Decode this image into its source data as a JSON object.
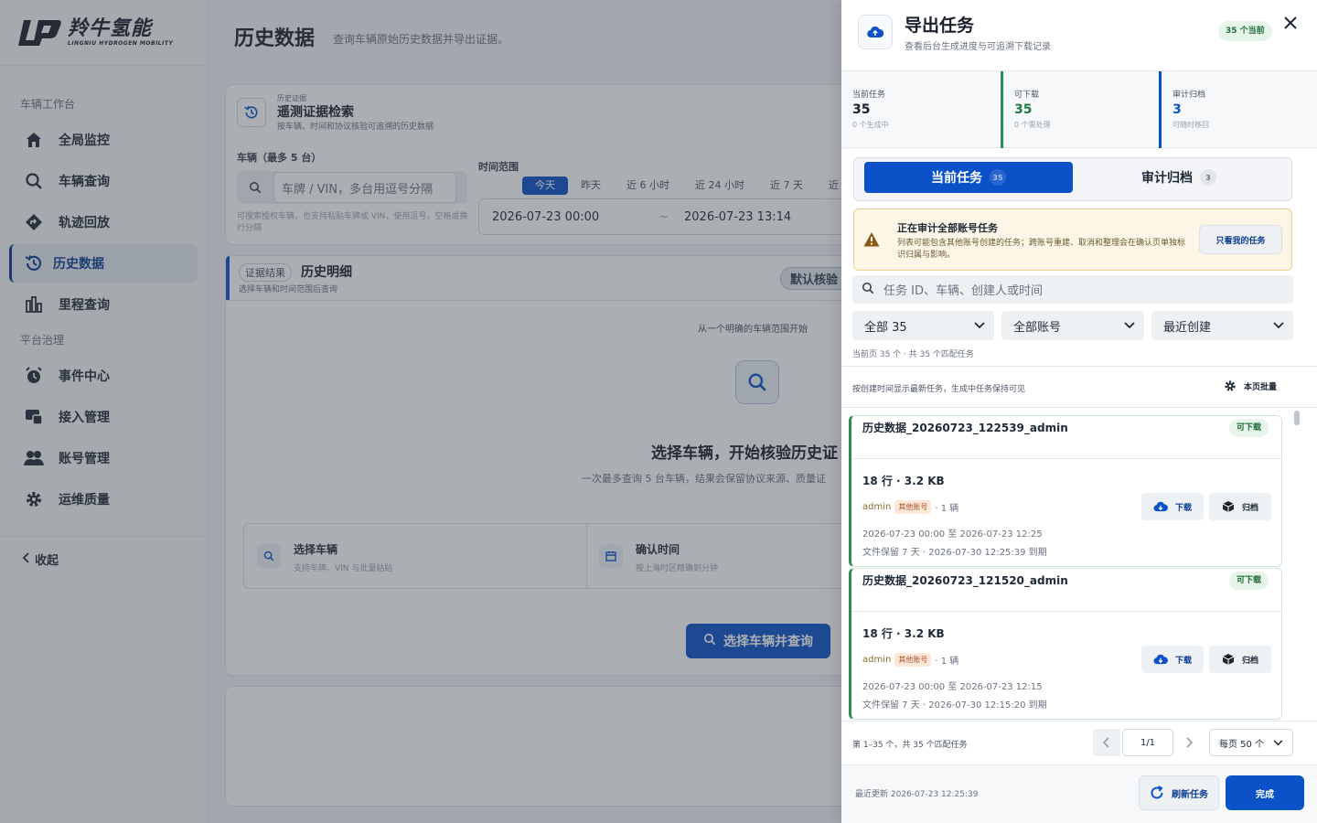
{
  "brand": {
    "name_cn": "羚牛氢能",
    "name_en": "LINGNIU HYDROGEN MOBILITY"
  },
  "sidebar": {
    "groups": [
      "车辆工作台",
      "平台治理"
    ],
    "items": [
      {
        "label": "全局监控",
        "icon": "home-icon"
      },
      {
        "label": "车辆查询",
        "icon": "search-icon"
      },
      {
        "label": "轨迹回放",
        "icon": "route-icon"
      },
      {
        "label": "历史数据",
        "icon": "history-icon",
        "active": true
      },
      {
        "label": "里程查询",
        "icon": "bar-chart-icon"
      },
      {
        "label": "事件中心",
        "icon": "alarm-clock-icon"
      },
      {
        "label": "接入管理",
        "icon": "device-icon"
      },
      {
        "label": "账号管理",
        "icon": "users-icon"
      },
      {
        "label": "运维质量",
        "icon": "gear-icon"
      }
    ],
    "collapse_label": "收起"
  },
  "page": {
    "title": "历史数据",
    "subtitle": "查询车辆原始历史数据并导出证据。",
    "search_card": {
      "mini": "历史证据",
      "title": "遥测证据检索",
      "desc": "按车辆、时间和协议核验可追溯的历史数据",
      "vehicle_label": "车辆（最多 5 台）",
      "vehicle_placeholder": "车牌 / VIN，多台用逗号分隔",
      "vehicle_hint": "可搜索授权车辆，也支持粘贴车牌或 VIN，使用逗号、空格或换行分隔",
      "time_label": "时间范围",
      "time_presets": [
        "今天",
        "昨天",
        "近 6 小时",
        "近 24 小时",
        "近 7 天",
        "近"
      ],
      "start_time": "2026-07-23 00:00",
      "separator": "~",
      "end_time": "2026-07-23 13:14"
    },
    "result_card": {
      "tag": "证据结果",
      "title": "历史明细",
      "desc": "选择车辆和时间范围后查询",
      "verify_tag": "默认核验 ·",
      "hint_top": "从一个明确的车辆范围开始",
      "empty_title": "选择车辆，开始核验历史证",
      "empty_desc": "一次最多查询 5 台车辆，结果会保留协议来源、质量证",
      "step1_title": "选择车辆",
      "step1_desc": "支持车牌、VIN 与批量粘贴",
      "step2_title": "确认时间",
      "step2_desc": "按上海时区精确到分钟",
      "query_button": "选择车辆并查询"
    }
  },
  "drawer": {
    "title": "导出任务",
    "subtitle": "查看后台生成进度与可追溯下载记录",
    "badge": "35 个当前",
    "stats": [
      {
        "label": "当前任务",
        "value": "35",
        "desc": "0 个生成中",
        "color": "#1a1f2b"
      },
      {
        "label": "可下载",
        "value": "35",
        "desc": "0 个需处理",
        "color": "#1f7a45"
      },
      {
        "label": "审计归档",
        "value": "3",
        "desc": "可随时移回",
        "color": "#0b52c9"
      }
    ],
    "tabs": [
      {
        "label": "当前任务",
        "count": "35"
      },
      {
        "label": "审计归档",
        "count": "3"
      }
    ],
    "warning": {
      "title": "正在审计全部账号任务",
      "desc": "列表可能包含其他账号创建的任务；跨账号重建、取消和整理会在确认页单独标识归属与影响。",
      "button": "只看我的任务"
    },
    "search_placeholder": "任务 ID、车辆、创建人或时间",
    "filters": [
      "全部 35",
      "全部账号",
      "最近创建"
    ],
    "match_text": "当前页 35 个 · 共 35 个匹配任务",
    "sort_text": "按创建时间显示最新任务，生成中任务保持可见",
    "batch_label": "本页批量",
    "tasks": [
      {
        "name": "历史数据_20260723_122539_admin",
        "status": "可下载",
        "size": "18 行 · 3.2 KB",
        "owner": "admin",
        "owner_tag": "其他账号",
        "vehicles": "· 1 辆",
        "range": "2026-07-23 00:00 至 2026-07-23 12:25",
        "keep": "文件保留 7 天 · 2026-07-30 12:25:39 到期",
        "download": "下载",
        "archive": "归档"
      },
      {
        "name": "历史数据_20260723_121520_admin",
        "status": "可下载",
        "size": "18 行 · 3.2 KB",
        "owner": "admin",
        "owner_tag": "其他账号",
        "vehicles": "· 1 辆",
        "range": "2026-07-23 00:00 至 2026-07-23 12:15",
        "keep": "文件保留 7 天 · 2026-07-30 12:15:20 到期",
        "download": "下载",
        "archive": "归档"
      }
    ],
    "pager_text": "第 1–35 个，共 35 个匹配任务",
    "page_num": "1/1",
    "page_size": "每页 50 个",
    "last_update": "最近更新 2026-07-23 12:25:39",
    "refresh_label": "刷新任务",
    "done_label": "完成"
  },
  "colors": {
    "primary": "#0b52c9",
    "success": "#1f7a45",
    "warning_bg": "#fdf6e7"
  }
}
